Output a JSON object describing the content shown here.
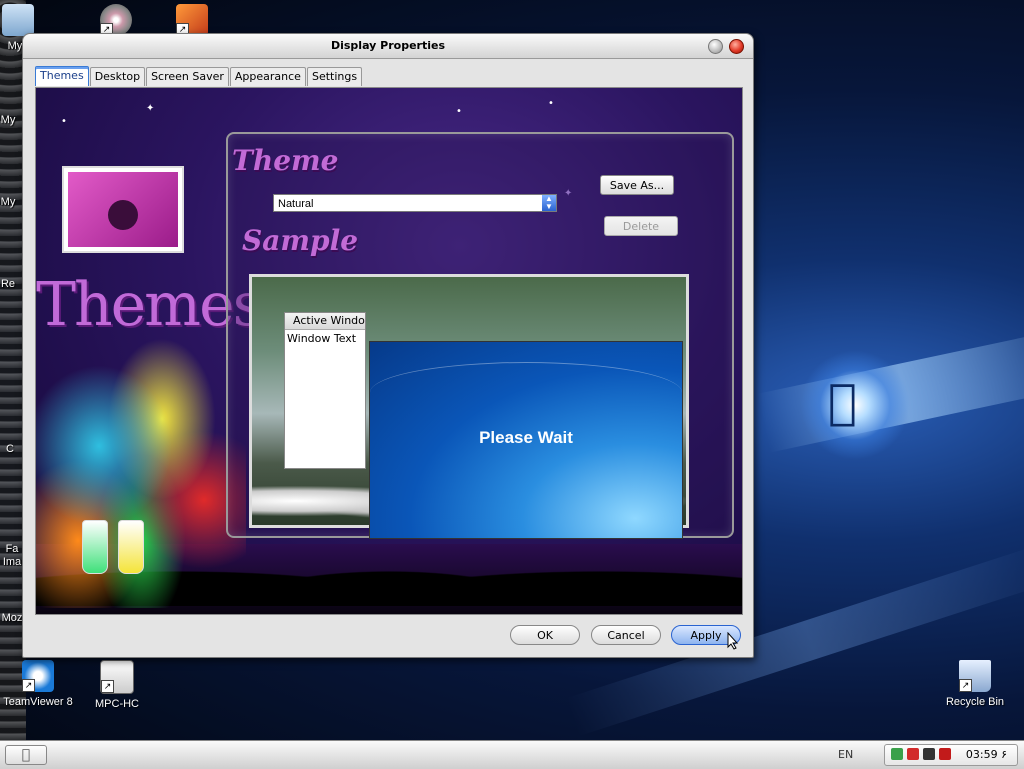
{
  "window": {
    "title": "Display Properties",
    "tabs": [
      {
        "label": "Themes",
        "active": true
      },
      {
        "label": "Desktop",
        "active": false
      },
      {
        "label": "Screen Saver",
        "active": false
      },
      {
        "label": "Appearance",
        "active": false
      },
      {
        "label": "Settings",
        "active": false
      }
    ],
    "buttons": {
      "ok": "OK",
      "cancel": "Cancel",
      "apply": "Apply"
    }
  },
  "themes_page": {
    "big_label": "Themes",
    "theme_label": "Theme",
    "sample_label": "Sample",
    "theme_select_value": "Natural",
    "save_as": "Save As...",
    "delete": "Delete",
    "preview": {
      "active_window_title": "Active Window",
      "window_text": "Window Text",
      "overlay_message": "Please Wait"
    }
  },
  "desktop_icons": [
    {
      "label": "My I",
      "icon": "folder-icon"
    },
    {
      "label": "",
      "icon": "cd-icon"
    },
    {
      "label": "",
      "icon": "shortcut-app-icon"
    },
    {
      "label": "My",
      "icon": "computer-icon"
    },
    {
      "label": "My",
      "icon": "network-icon"
    },
    {
      "label": "Re",
      "icon": "recycle-icon"
    },
    {
      "label": "C",
      "icon": "app-icon"
    },
    {
      "label": "Fa\nIma",
      "icon": "image-icon"
    },
    {
      "label": "Moz",
      "icon": "browser-icon"
    },
    {
      "label": "TeamViewer 8",
      "icon": "teamviewer-icon"
    },
    {
      "label": "MPC-HC",
      "icon": "mpc-hc-icon"
    },
    {
      "label": "Recycle Bin",
      "icon": "recycle-bin-icon"
    }
  ],
  "taskbar": {
    "start_icon": "apple-icon",
    "language": "EN",
    "clock": "03:59 ۶",
    "tray_icons": [
      "network-icon",
      "shield-icon",
      "antivirus-icon",
      "dollar-icon"
    ]
  },
  "colors": {
    "accent_blue": "#2a63d0",
    "script_purple": "#c26bd6",
    "panel_purple": "#2b1560",
    "close_red": "#e23a28"
  }
}
